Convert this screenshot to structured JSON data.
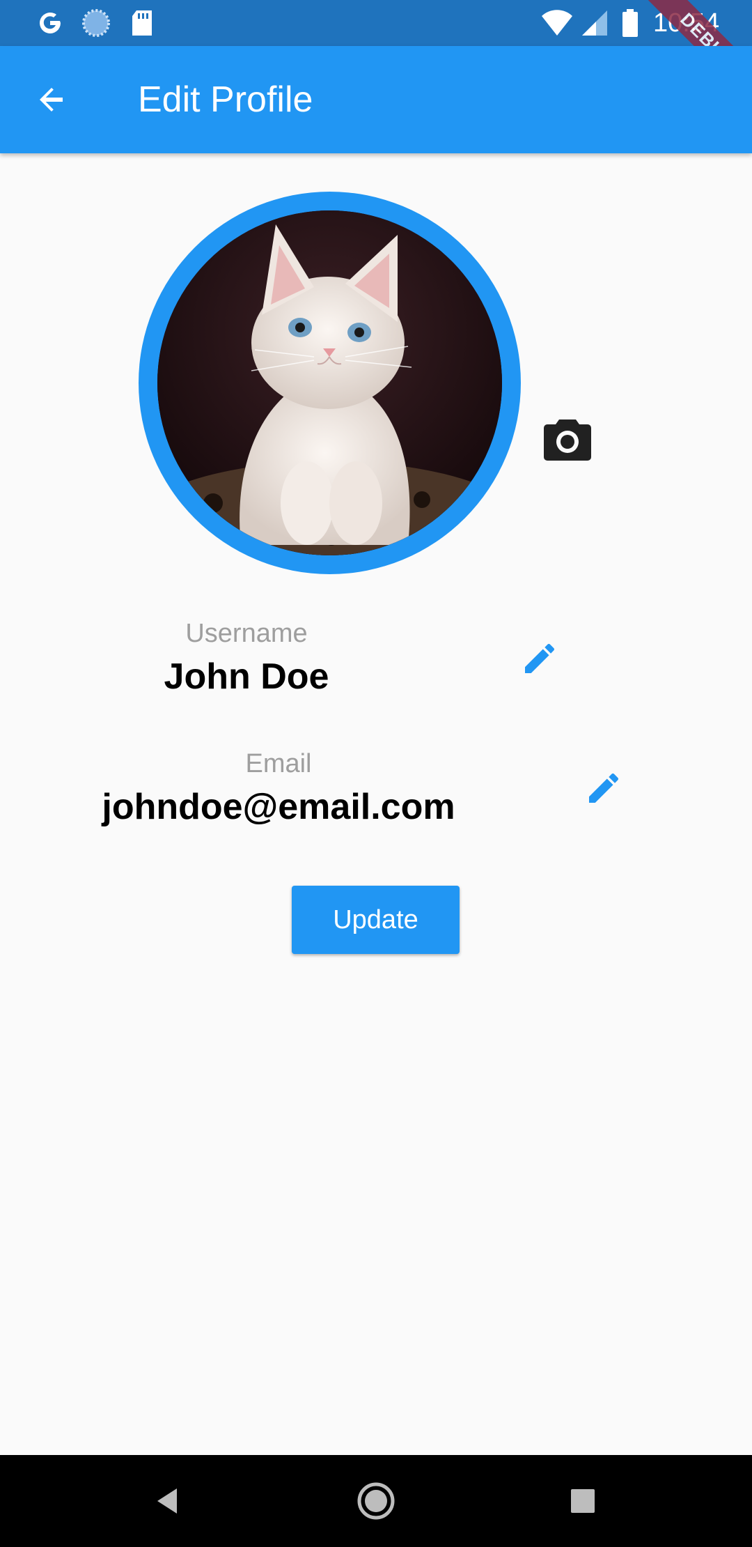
{
  "status_bar": {
    "time": "10:54",
    "icons": [
      "google-icon",
      "sync-icon",
      "sd-card-icon",
      "wifi-icon",
      "signal-icon",
      "battery-icon"
    ]
  },
  "debug_banner": "DEBUG",
  "app_bar": {
    "title": "Edit Profile",
    "back_icon": "arrow-back-icon",
    "color": "#2196f3"
  },
  "profile": {
    "avatar": "kitten-photo",
    "camera_icon": "camera-icon"
  },
  "fields": {
    "username": {
      "label": "Username",
      "value": "John Doe",
      "edit_icon": "pencil-icon"
    },
    "email": {
      "label": "Email",
      "value": "johndoe@email.com",
      "edit_icon": "pencil-icon"
    }
  },
  "actions": {
    "update_label": "Update"
  },
  "nav_bar": {
    "icons": [
      "back-triangle-icon",
      "home-circle-icon",
      "recents-square-icon"
    ]
  },
  "colors": {
    "primary": "#2196f3",
    "status_bar": "#1f73bd",
    "background": "#fafafa",
    "label_gray": "#9e9e9e"
  }
}
